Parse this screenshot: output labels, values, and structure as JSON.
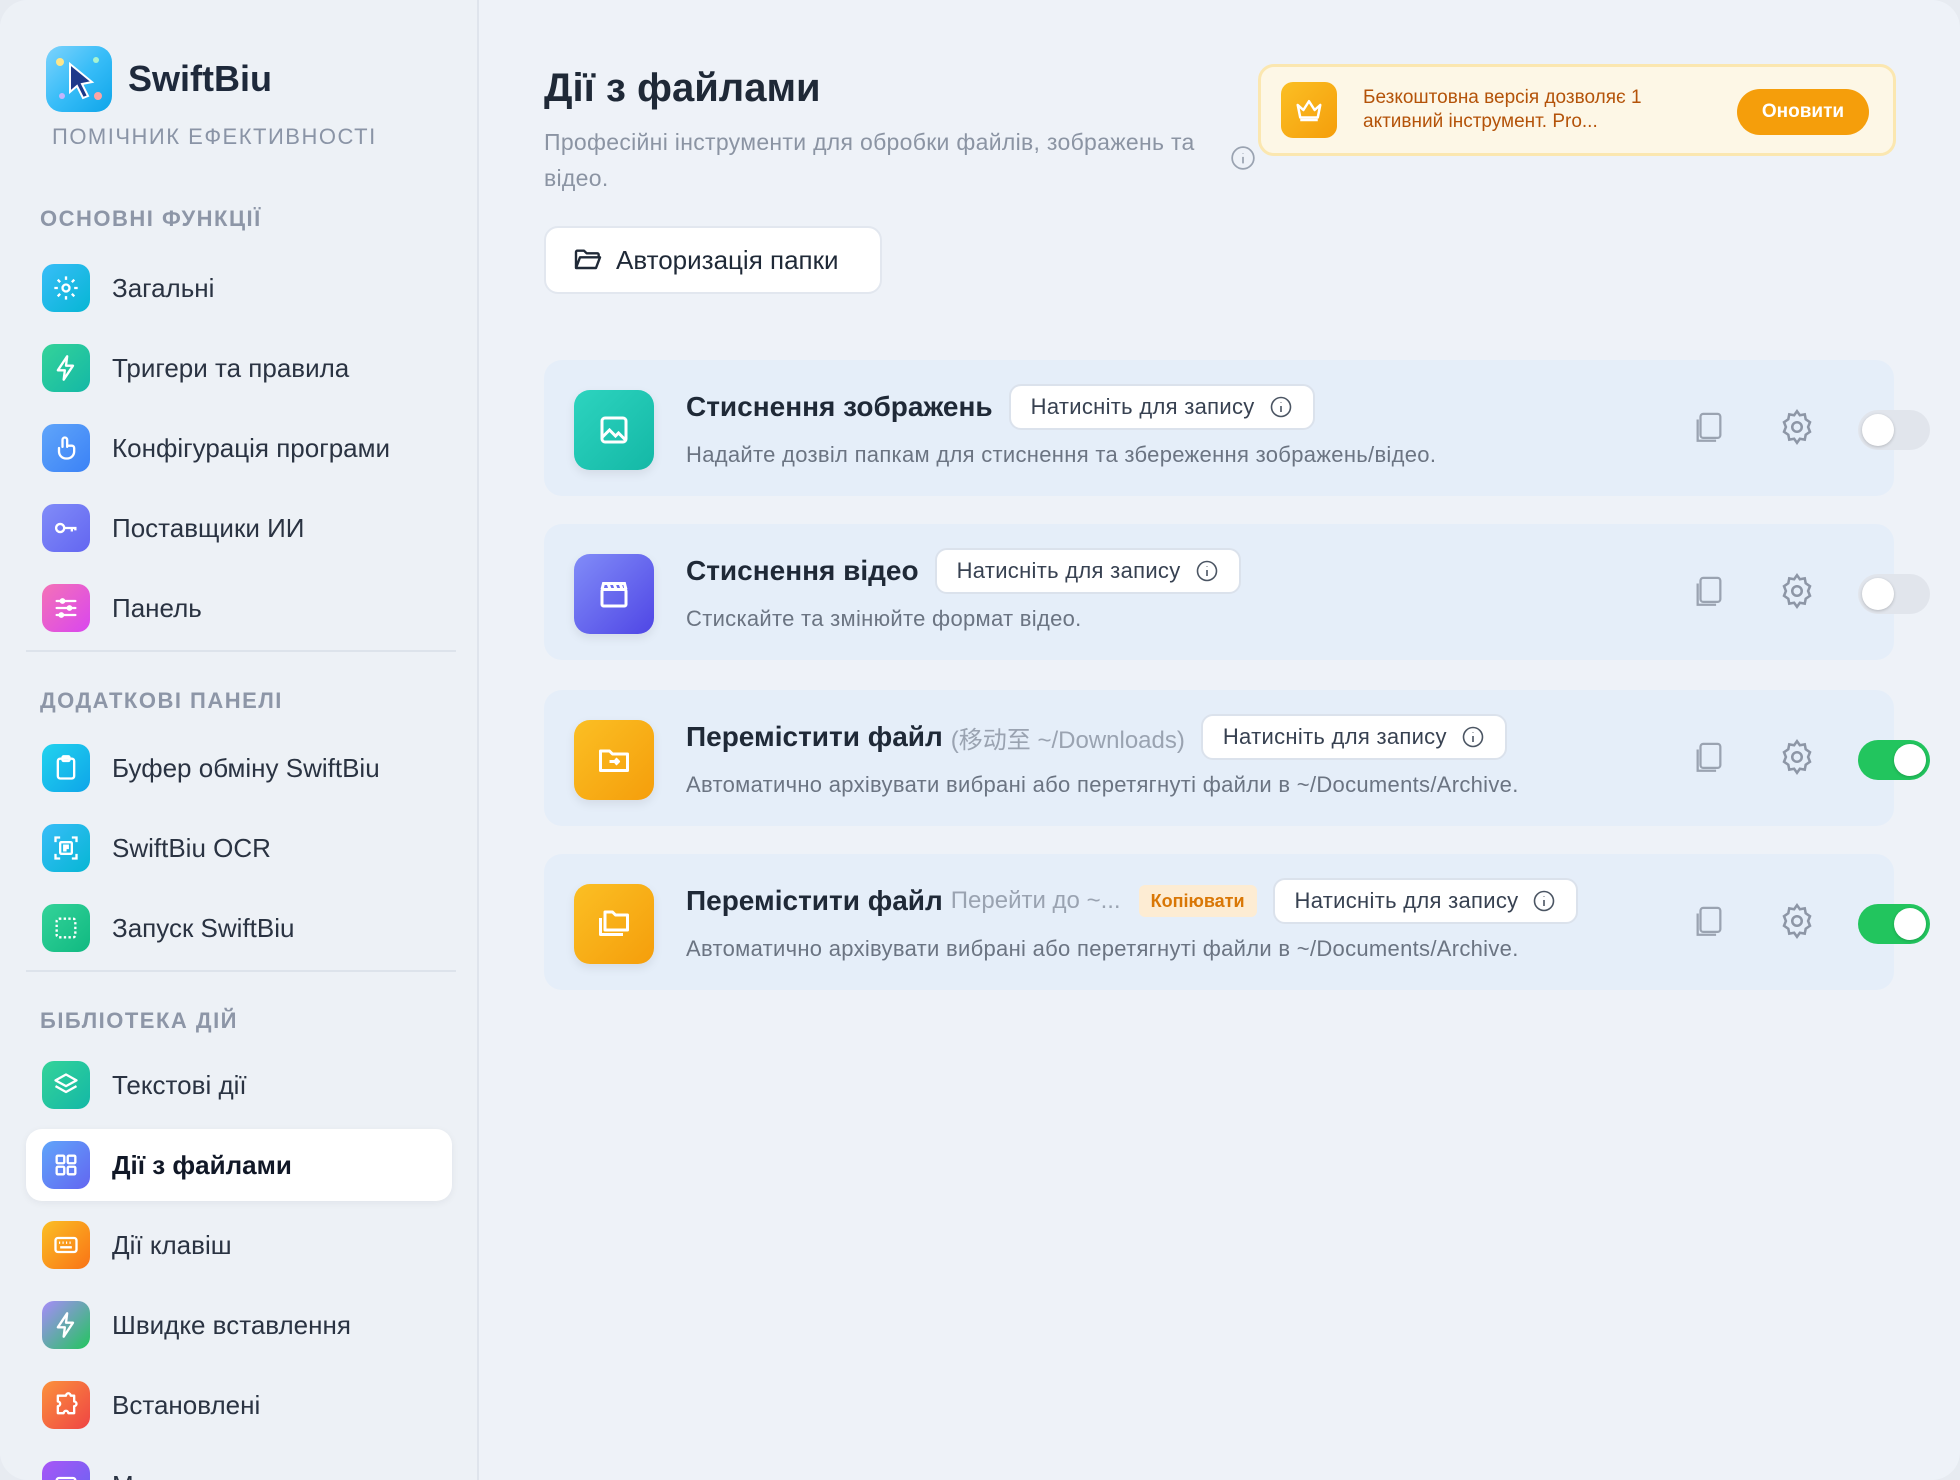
{
  "sidebar": {
    "brand_name": "SwiftBiu",
    "brand_subtitle": "ПОМІЧНИК ЕФЕКТИВНОСТІ",
    "section_core": "ОСНОВНІ ФУНКЦІЇ",
    "section_panels": "ДОДАТКОВІ ПАНЕЛІ",
    "section_library": "БІБЛІОТЕКА ДІЙ",
    "items": [
      {
        "label": "Загальні"
      },
      {
        "label": "Тригери та правила"
      },
      {
        "label": "Конфігурація програми"
      },
      {
        "label": "Поставщики ИИ"
      },
      {
        "label": "Панель"
      },
      {
        "label": "Буфер обміну SwiftBiu"
      },
      {
        "label": "SwiftBiu OCR"
      },
      {
        "label": "Запуск SwiftBiu"
      },
      {
        "label": "Текстові дії"
      },
      {
        "label": "Дії з файлами"
      },
      {
        "label": "Дії клавіш"
      },
      {
        "label": "Швидке вставлення"
      },
      {
        "label": "Встановлені"
      },
      {
        "label": "М"
      }
    ],
    "active_item": "Дії з файлами"
  },
  "header": {
    "title": "Дії з файлами",
    "description": "Професійні інструменти для обробки файлів, зображень та відео.",
    "auth_button": "Авторизація папки"
  },
  "promo": {
    "text": "Безкоштовна версія дозволяє 1 активний інструмент. Pro...",
    "button": "Оновити"
  },
  "cards": [
    {
      "title": "Стиснення зображень",
      "subtitle": "",
      "badge": "",
      "record_label": "Натисніть для запису",
      "description": "Надайте дозвіл папкам для стиснення та збереження зображень/відео.",
      "enabled": false,
      "icon": "image-icon"
    },
    {
      "title": "Стиснення відео",
      "subtitle": "",
      "badge": "",
      "record_label": "Натисніть для запису",
      "description": "Стискайте та змінюйте формат відео.",
      "enabled": false,
      "icon": "clapperboard-icon"
    },
    {
      "title": "Перемістити файл",
      "subtitle": "(移动至 ~/Downloads)",
      "badge": "",
      "record_label": "Натисніть для запису",
      "description": "Автоматично архівувати вибрані або перетягнуті файли в ~/Documents/Archive.",
      "enabled": true,
      "icon": "folder-arrow-icon"
    },
    {
      "title": "Перемістити файл",
      "subtitle": "Перейти до ~...",
      "badge": "Копіювати",
      "record_label": "Натисніть для запису",
      "description": "Автоматично архівувати вибрані або перетягнуті файли в ~/Documents/Archive.",
      "enabled": true,
      "icon": "folders-icon"
    }
  ],
  "colors": {
    "accent_orange": "#f59e0b",
    "toggle_on": "#22c55e",
    "toggle_off": "#e1e5ec",
    "active_bg": "#ffffff"
  }
}
